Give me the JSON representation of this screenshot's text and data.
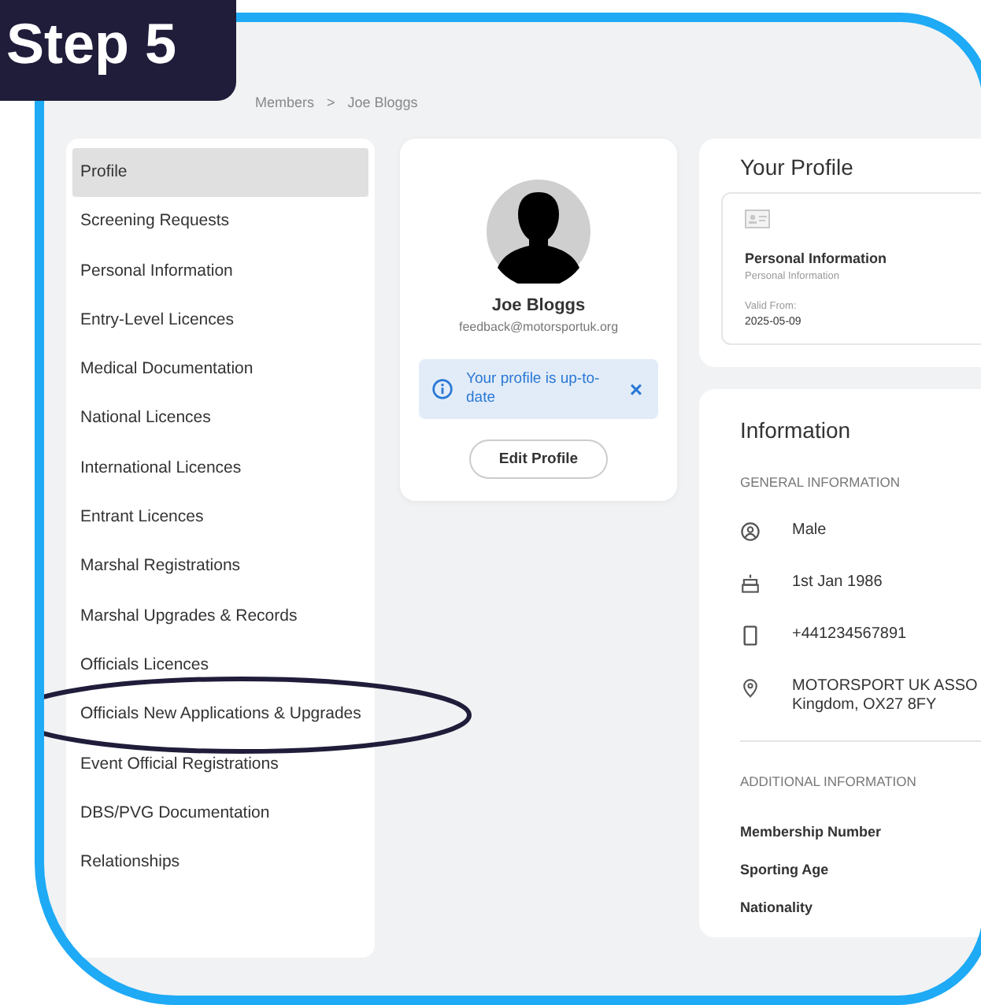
{
  "step_badge": "Step 5",
  "breadcrumb": [
    "Members",
    ">",
    "Joe Bloggs"
  ],
  "sidebar": {
    "items": [
      {
        "label": "Profile",
        "selected": true,
        "circled": false
      },
      {
        "label": "Screening Requests",
        "selected": false,
        "circled": false
      },
      {
        "label": "Personal Information",
        "selected": false,
        "circled": false
      },
      {
        "label": "Entry-Level Licences",
        "selected": false,
        "circled": false
      },
      {
        "label": "Medical Documentation",
        "selected": false,
        "circled": false
      },
      {
        "label": "National Licences",
        "selected": false,
        "circled": false
      },
      {
        "label": "International Licences",
        "selected": false,
        "circled": false
      },
      {
        "label": "Entrant Licences",
        "selected": false,
        "circled": false
      },
      {
        "label": "Marshal Registrations",
        "selected": false,
        "circled": false
      },
      {
        "label": "Marshal Upgrades & Records",
        "selected": false,
        "circled": false
      },
      {
        "label": "Officials Licences",
        "selected": false,
        "circled": false
      },
      {
        "label": "Officials New Applications & Upgrades",
        "selected": false,
        "circled": true
      },
      {
        "label": "Event Official Registrations",
        "selected": false,
        "circled": false
      },
      {
        "label": "DBS/PVG Documentation",
        "selected": false,
        "circled": false
      },
      {
        "label": "Relationships",
        "selected": false,
        "circled": false
      }
    ]
  },
  "profile_card": {
    "name": "Joe Bloggs",
    "email": "feedback@motorsportuk.org",
    "alert": {
      "text": "Your profile is up-to-date",
      "close": "×"
    },
    "button": "Edit Profile"
  },
  "your_profile": {
    "title": "Your Profile",
    "card": {
      "title": "Personal Information",
      "subtitle": "Personal Information",
      "valid_label": "Valid From:",
      "valid_date": "2025-05-09"
    }
  },
  "information": {
    "title": "Information",
    "general_heading": "GENERAL INFORMATION",
    "general": [
      {
        "kind": "gender",
        "lines": [
          "Male"
        ]
      },
      {
        "kind": "birthday",
        "lines": [
          "1st Jan 1986"
        ]
      },
      {
        "kind": "phone",
        "lines": [
          "+441234567891"
        ]
      },
      {
        "kind": "address",
        "lines": [
          "MOTORSPORT UK ASSO",
          "Kingdom, OX27 8FY"
        ]
      }
    ],
    "additional_heading": "ADDITIONAL INFORMATION",
    "additional": [
      "Membership Number",
      "Sporting Age",
      "Nationality"
    ]
  }
}
